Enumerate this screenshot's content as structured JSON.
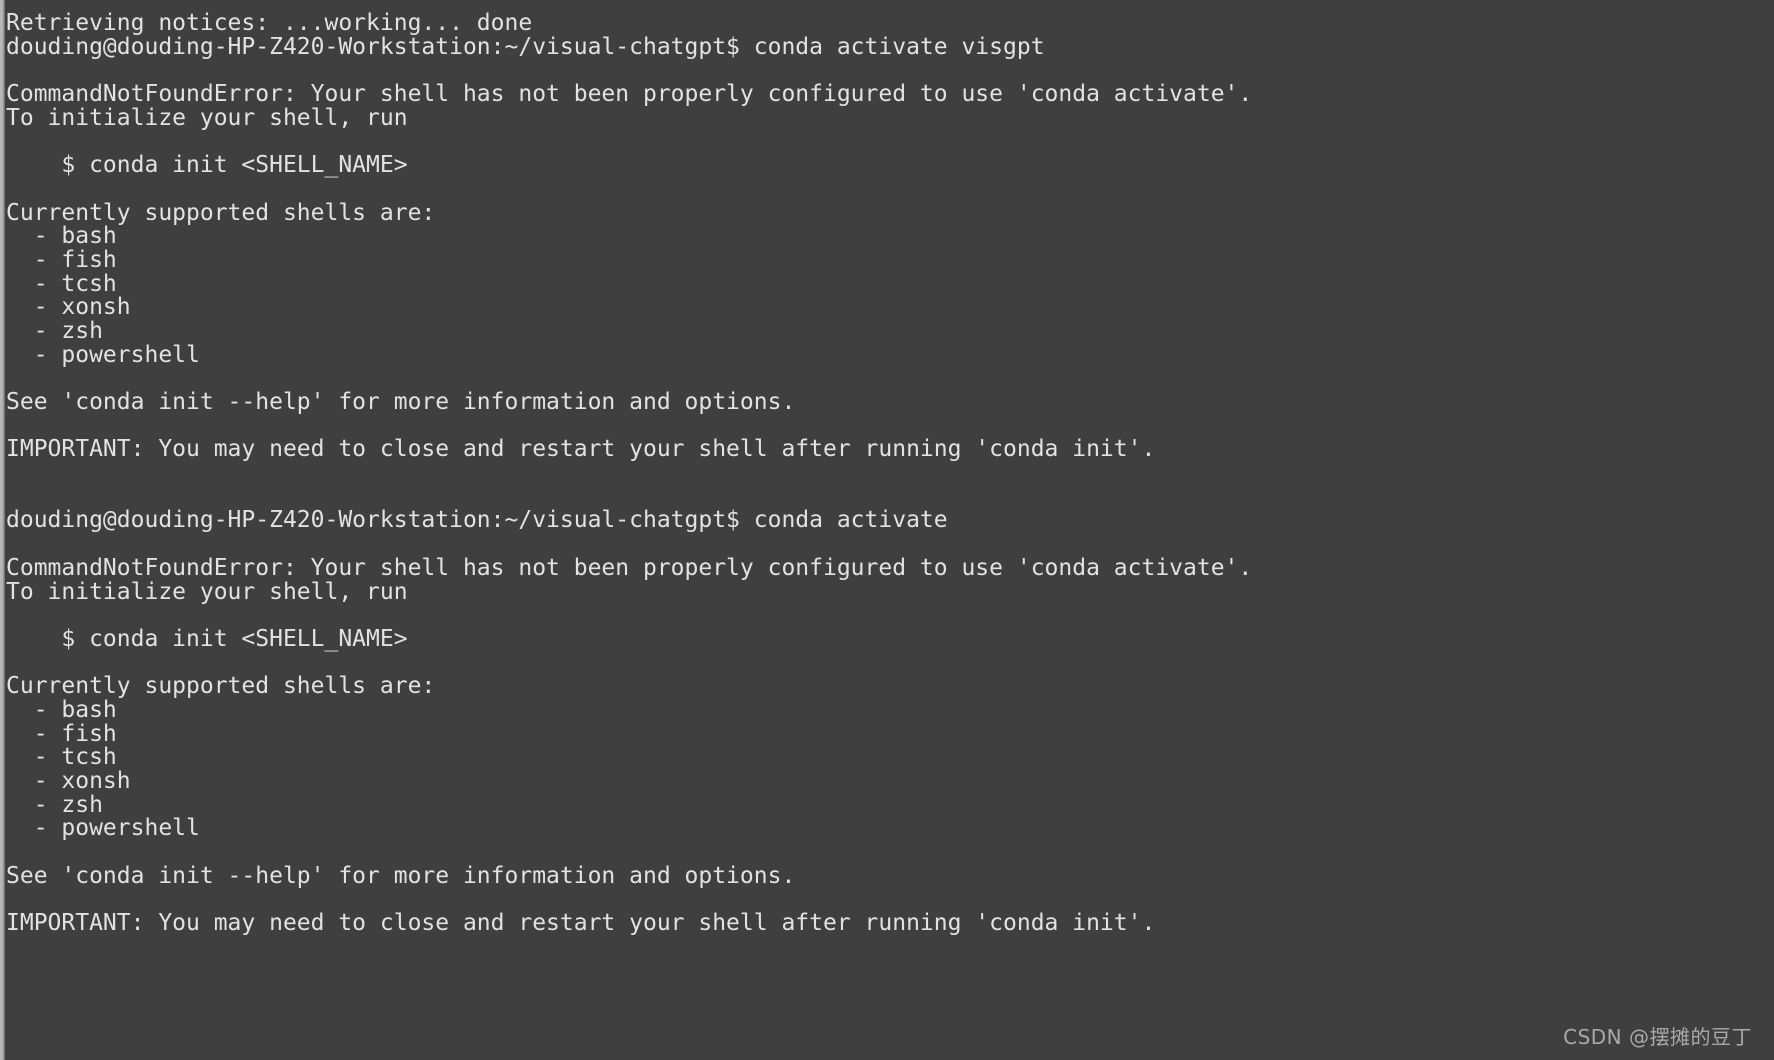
{
  "terminal": {
    "background_color": "#3f3f3f",
    "text_color": "#e2e2e2",
    "prompt": "douding@douding-HP-Z420-Workstation:~/visual-chatgpt$",
    "lines": [
      "Retrieving notices: ...working... done",
      "douding@douding-HP-Z420-Workstation:~/visual-chatgpt$ conda activate visgpt",
      "",
      "CommandNotFoundError: Your shell has not been properly configured to use 'conda activate'.",
      "To initialize your shell, run",
      "",
      "    $ conda init <SHELL_NAME>",
      "",
      "Currently supported shells are:",
      "  - bash",
      "  - fish",
      "  - tcsh",
      "  - xonsh",
      "  - zsh",
      "  - powershell",
      "",
      "See 'conda init --help' for more information and options.",
      "",
      "IMPORTANT: You may need to close and restart your shell after running 'conda init'.",
      "",
      "",
      "douding@douding-HP-Z420-Workstation:~/visual-chatgpt$ conda activate",
      "",
      "CommandNotFoundError: Your shell has not been properly configured to use 'conda activate'.",
      "To initialize your shell, run",
      "",
      "    $ conda init <SHELL_NAME>",
      "",
      "Currently supported shells are:",
      "  - bash",
      "  - fish",
      "  - tcsh",
      "  - xonsh",
      "  - zsh",
      "  - powershell",
      "",
      "See 'conda init --help' for more information and options.",
      "",
      "IMPORTANT: You may need to close and restart your shell after running 'conda init'."
    ]
  },
  "watermark": {
    "text": "CSDN @摆摊的豆丁",
    "color": "#a9a9a9"
  }
}
